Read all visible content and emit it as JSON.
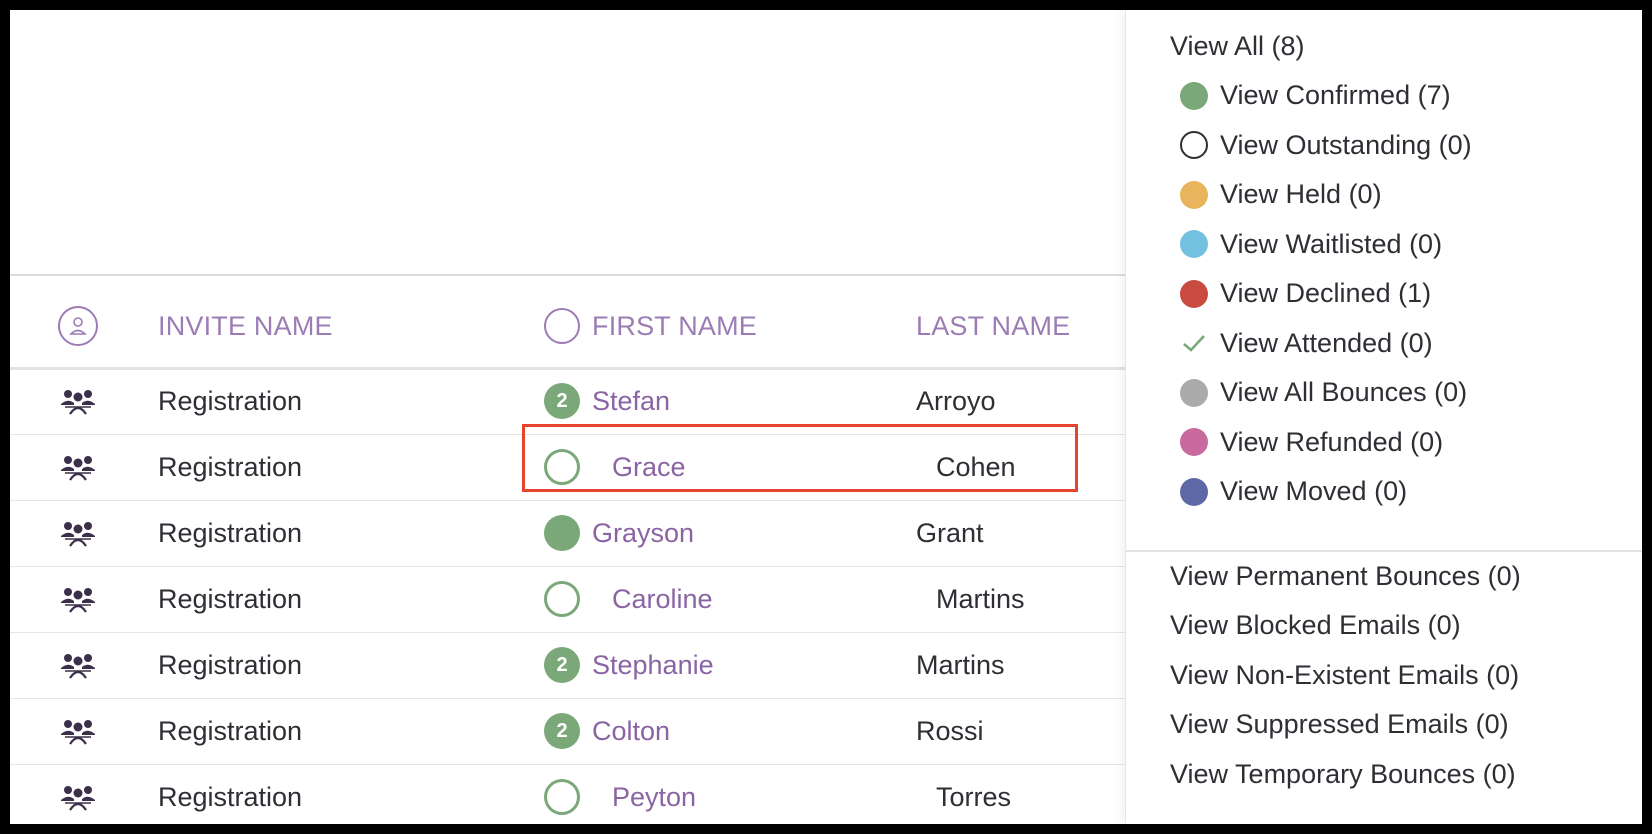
{
  "table": {
    "headers": {
      "invite_name": "INVITE NAME",
      "first_name": "FIRST NAME",
      "last_name": "LAST NAME"
    },
    "rows": [
      {
        "invite": "Registration",
        "status": "filled",
        "badge": "2",
        "first": "Stefan",
        "last": "Arroyo"
      },
      {
        "invite": "Registration",
        "status": "empty",
        "badge": "",
        "first": "Grace",
        "last": "Cohen"
      },
      {
        "invite": "Registration",
        "status": "filled",
        "badge": "",
        "first": "Grayson",
        "last": "Grant"
      },
      {
        "invite": "Registration",
        "status": "empty",
        "badge": "",
        "first": "Caroline",
        "last": "Martins"
      },
      {
        "invite": "Registration",
        "status": "filled",
        "badge": "2",
        "first": "Stephanie",
        "last": "Martins"
      },
      {
        "invite": "Registration",
        "status": "filled",
        "badge": "2",
        "first": "Colton",
        "last": "Rossi"
      },
      {
        "invite": "Registration",
        "status": "empty",
        "badge": "",
        "first": "Peyton",
        "last": "Torres"
      }
    ]
  },
  "dropdown": {
    "items": [
      {
        "label": "View All (8)",
        "marker": "none",
        "color": ""
      },
      {
        "label": "View Confirmed (7)",
        "marker": "dot",
        "color": "#7aa879"
      },
      {
        "label": "View Outstanding (0)",
        "marker": "ring",
        "color": "#2e2e34"
      },
      {
        "label": "View Held (0)",
        "marker": "dot",
        "color": "#e8b55c"
      },
      {
        "label": "View Waitlisted (0)",
        "marker": "dot",
        "color": "#72c2df"
      },
      {
        "label": "View Declined (1)",
        "marker": "dot",
        "color": "#c94a3f"
      },
      {
        "label": "View Attended (0)",
        "marker": "check",
        "color": "#7aa879"
      },
      {
        "label": "View All Bounces (0)",
        "marker": "dot",
        "color": "#ababab"
      },
      {
        "label": "View Refunded (0)",
        "marker": "dot",
        "color": "#c96a9f"
      },
      {
        "label": "View Moved (0)",
        "marker": "dot",
        "color": "#5e68a6"
      }
    ],
    "email_items": [
      {
        "label": "View Permanent Bounces (0)"
      },
      {
        "label": "View Blocked Emails (0)"
      },
      {
        "label": "View Non-Existent Emails (0)"
      },
      {
        "label": "View Suppressed Emails (0)"
      },
      {
        "label": "View Temporary Bounces (0)"
      }
    ]
  },
  "colors": {
    "accent_purple": "#8a64a3",
    "header_purple": "#9c7cb4",
    "confirmed_green": "#7aa879",
    "highlight_red": "#e5452c"
  }
}
